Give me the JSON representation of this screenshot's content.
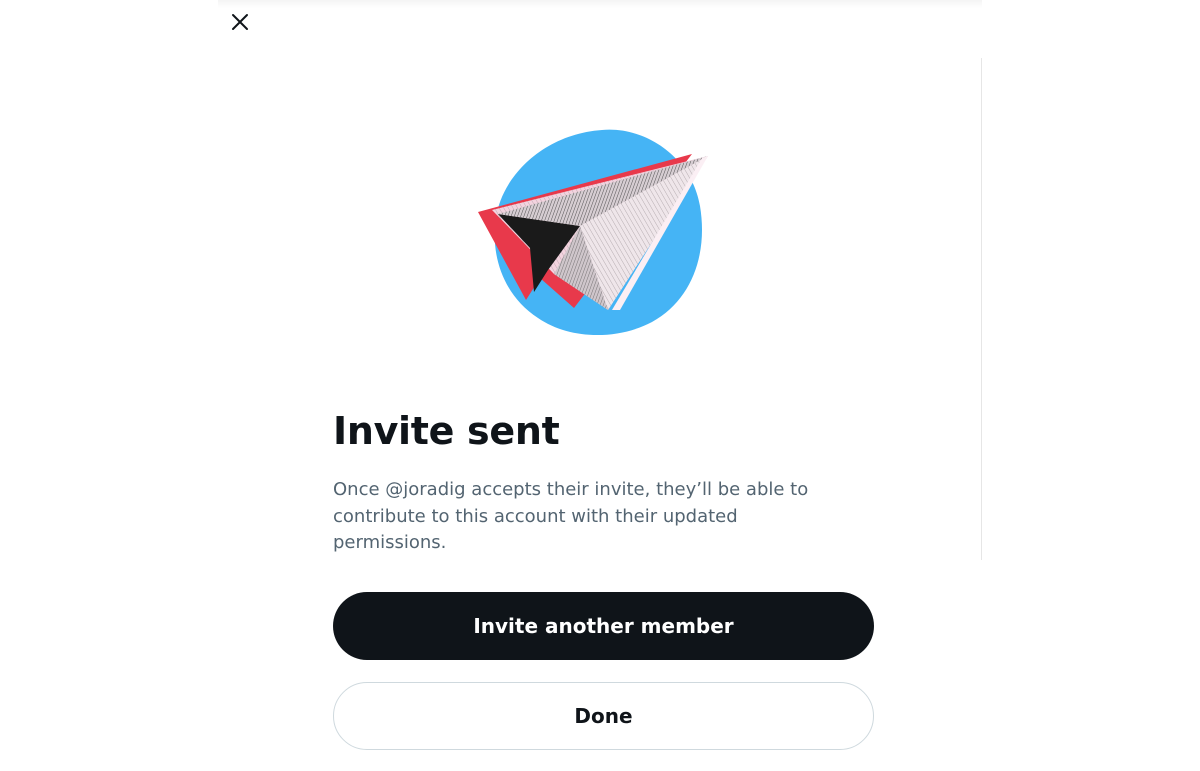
{
  "dialog": {
    "title": "Invite sent",
    "description": "Once @joradig accepts their invite, they’ll be able to contribute to this account with their updated permissions.",
    "primary_button_label": "Invite another member",
    "secondary_button_label": "Done",
    "close_icon": "close-icon",
    "illustration_icon": "paper-plane-illustration"
  },
  "colors": {
    "primary_button_bg": "#0f1419",
    "secondary_text": "#536471",
    "illustration_blue": "#45b4f5",
    "illustration_red": "#e8394b",
    "illustration_pink": "#f3d3df"
  }
}
